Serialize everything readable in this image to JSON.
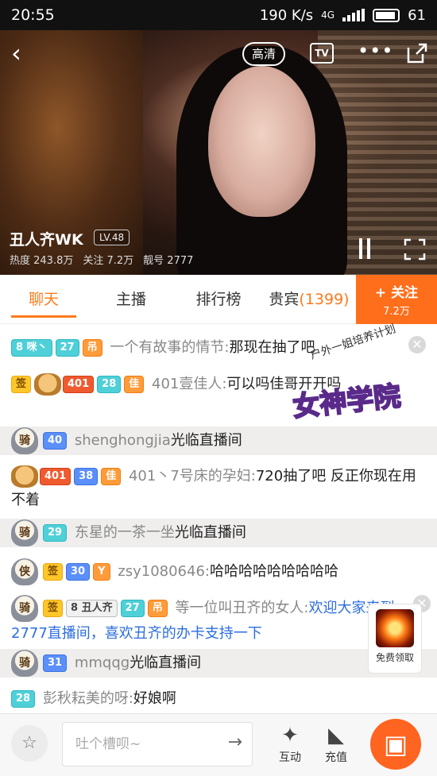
{
  "status": {
    "time": "20:55",
    "speed": "190 K/s",
    "network": "4G",
    "battery": "61"
  },
  "video": {
    "quality_label": "高清",
    "tv_label": "TV",
    "streamer_name": "丑人齐WK",
    "level": "LV.48",
    "heat": "热度 243.8万",
    "followers": "关注 7.2万",
    "room_id": "靓号 2777"
  },
  "tabs": [
    {
      "label": "聊天"
    },
    {
      "label": "主播"
    },
    {
      "label": "排行榜"
    },
    {
      "label": "贵宾",
      "count": "(1399)"
    }
  ],
  "follow": {
    "label": "+ 关注",
    "count": "7.2万"
  },
  "chat": [
    {
      "badges": [
        "8 咪丶",
        "27",
        "吊"
      ],
      "user": "一个有故事的情节:",
      "text": "那现在抽了吧"
    },
    {
      "badges": [
        "签",
        "401",
        "28",
        "佳"
      ],
      "user": "401壹佳人:",
      "text": "可以吗佳哥开开吗"
    },
    {
      "badges": [
        "骑",
        "40"
      ],
      "user": "shenghongjia",
      "text": "光临直播间"
    },
    {
      "badges": [
        "401",
        "38",
        "佳"
      ],
      "user": "401丶7号床的孕妇:",
      "text": "720抽了吧 反正你现在用不着"
    },
    {
      "badges": [
        "骑",
        "29"
      ],
      "user": "东星的一茶一坐",
      "text": "光临直播间"
    },
    {
      "badges": [
        "侠",
        "签",
        "30",
        "Y"
      ],
      "user": "zsy1080646:",
      "text": "哈哈哈哈哈哈哈哈哈"
    },
    {
      "badges": [
        "骑",
        "签",
        "8 丑人齐",
        "27",
        "吊"
      ],
      "user": "等一位叫丑齐的女人:",
      "text": "欢迎大家来到2777直播间，喜欢丑齐的办卡支持一下"
    },
    {
      "badges": [
        "骑",
        "31"
      ],
      "user": "mmqqg",
      "text": "光临直播间"
    },
    {
      "badges": [
        "28"
      ],
      "user": "彭秋耘美的呀:",
      "text": "好娘啊"
    }
  ],
  "promo": {
    "caption": "户外一姐培养计划",
    "title": "女神学院"
  },
  "ad": {
    "label": "免费领取"
  },
  "bottom": {
    "placeholder": "吐个槽呗~",
    "interact_label": "互动",
    "recharge_label": "充值"
  }
}
